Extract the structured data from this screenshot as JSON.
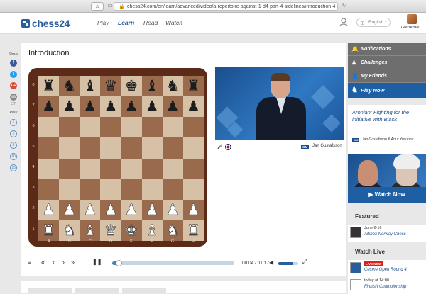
{
  "browser": {
    "url": "chess24.com/en/learn/advanced/video/a-repertoire-against-1-d4-part-4-sidelines/introduction-4",
    "home_icon": "home-icon",
    "tabs_icon": "tabs-icon"
  },
  "topnav": {
    "logo": "chess24",
    "items": [
      "Play",
      "Learn",
      "Read",
      "Watch"
    ],
    "active": "Learn",
    "language": "English",
    "username": "Gletzkows..."
  },
  "share": {
    "label": "Share",
    "networks": [
      "f",
      "t",
      "G+",
      "m"
    ],
    "count": "37",
    "playlist_label": "Play",
    "playlist": [
      "1",
      "2",
      "3",
      "10",
      "15"
    ]
  },
  "main": {
    "title": "Introduction",
    "ranks": [
      "8",
      "7",
      "6",
      "5",
      "4",
      "3",
      "2",
      "1"
    ],
    "files": [
      "A",
      "B",
      "C",
      "D",
      "E",
      "F",
      "G",
      "H"
    ],
    "video": {
      "tag": "GM",
      "presenter": "Jan Gustafsson"
    },
    "controls": {
      "time": "00:04 / 01:17",
      "progress": 0.05,
      "volume": 0.75
    }
  },
  "sidebar": {
    "items": [
      "Notifications",
      "Challenges",
      "My Friends",
      "Play Now"
    ],
    "news": {
      "headline": "Aronian: Fighting for the initiative with Black",
      "tag": "GM",
      "authors": "Jan Gustafsson & Artur Yusupov"
    },
    "watch_now": "Watch Now",
    "featured_label": "Featured",
    "featured": {
      "date": "June 6-16",
      "name": "Altibox Norway Chess"
    },
    "watch_live_label": "Watch Live",
    "live_badge": "LIVE NOW",
    "live": [
      {
        "name": "Cesme Open Round 4"
      },
      {
        "date": "today at 14:00",
        "name": "Finnish Championship"
      }
    ]
  },
  "colors": {
    "brand": "#2a5e9b",
    "sidebar_grey": "#6e6e6e",
    "play_now": "#1e5fa4",
    "live": "#d9211e"
  }
}
